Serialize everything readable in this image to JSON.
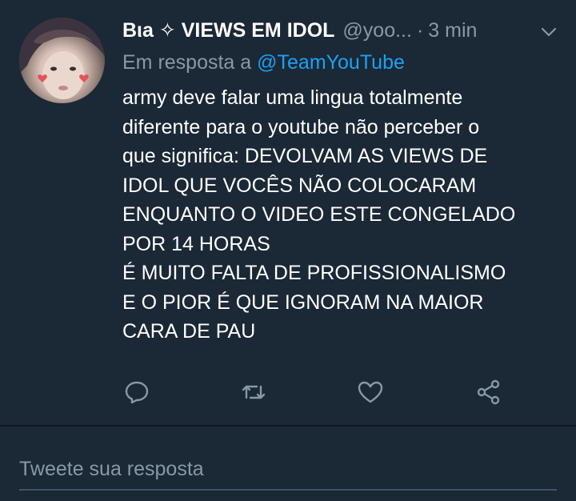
{
  "tweet": {
    "display_name": "Bιa ✧ VIEWS EM IDOL",
    "handle": "@yoo...",
    "separator": "·",
    "time": "3 min",
    "reply_prefix": "Em resposta a",
    "reply_mention": "@TeamYouTube",
    "body_lines": [
      "army deve falar uma lingua totalmente",
      "diferente para o youtube não perceber o",
      "que significa: DEVOLVAM AS VIEWS DE",
      "IDOL QUE VOCÊS NÃO COLOCARAM",
      "ENQUANTO O VIDEO ESTE CONGELADO",
      "POR 14 HORAS",
      "É MUITO FALTA DE PROFISSIONALISMO",
      "E O PIOR É QUE IGNORAM NA MAIOR",
      "CARA DE PAU"
    ]
  },
  "actions": [
    {
      "name": "reply",
      "icon": "reply-icon"
    },
    {
      "name": "retweet",
      "icon": "retweet-icon"
    },
    {
      "name": "like",
      "icon": "heart-icon"
    },
    {
      "name": "share",
      "icon": "share-icon"
    }
  ],
  "composer": {
    "placeholder": "Tweete sua resposta"
  },
  "colors": {
    "background": "#1b2836",
    "secondary_text": "#8899a6",
    "accent": "#1da1f2",
    "icon": "#8899a6",
    "divider": "#10171e"
  }
}
